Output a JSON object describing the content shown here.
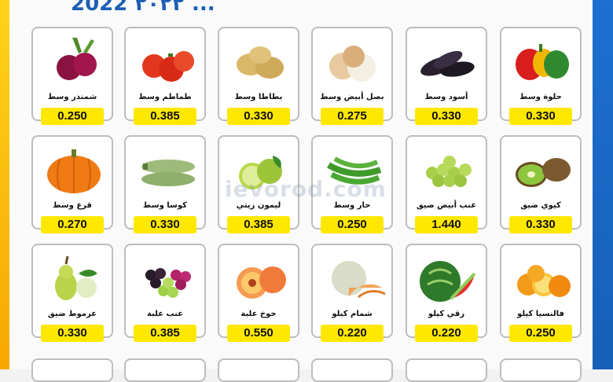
{
  "header": {
    "partial_text": "2022 ٢٠٢٢ ..."
  },
  "watermark": "ievorod.com",
  "colors": {
    "price_bg": "#ffe800",
    "left_stripe": "#ffd21a",
    "right_stripe": "#1e6fd0",
    "card_border": "#bdbdbd"
  },
  "products": [
    {
      "name": "حلوة وسط",
      "price": "0.330",
      "icon": "bell-peppers"
    },
    {
      "name": "أسود وسط",
      "price": "0.330",
      "icon": "eggplant"
    },
    {
      "name": "بصل أبيض وسط",
      "price": "0.275",
      "icon": "white-onion"
    },
    {
      "name": "بطاطا وسط",
      "price": "0.330",
      "icon": "potato"
    },
    {
      "name": "طماطم وسط",
      "price": "0.385",
      "icon": "tomato"
    },
    {
      "name": "شمندر وسط",
      "price": "0.250",
      "icon": "beetroot"
    },
    {
      "name": "كيوي ضيق",
      "price": "0.330",
      "icon": "kiwi"
    },
    {
      "name": "عنب أبيض ضيق",
      "price": "1.440",
      "icon": "green-grapes"
    },
    {
      "name": "حار وسط",
      "price": "0.250",
      "icon": "green-chili"
    },
    {
      "name": "ليمون زيتي",
      "price": "0.385",
      "icon": "lime"
    },
    {
      "name": "كوسا وسط",
      "price": "0.330",
      "icon": "zucchini"
    },
    {
      "name": "قرع وسط",
      "price": "0.270",
      "icon": "pumpkin"
    },
    {
      "name": "فالنسيا كيلو",
      "price": "0.250",
      "icon": "orange"
    },
    {
      "name": "رقي كيلو",
      "price": "0.220",
      "icon": "watermelon"
    },
    {
      "name": "شمام كيلو",
      "price": "0.220",
      "icon": "melon"
    },
    {
      "name": "خوخ علبة",
      "price": "0.550",
      "icon": "peach"
    },
    {
      "name": "عنب علبة",
      "price": "0.385",
      "icon": "grapes-mix"
    },
    {
      "name": "عرموط ضيق",
      "price": "0.330",
      "icon": "pear"
    }
  ]
}
